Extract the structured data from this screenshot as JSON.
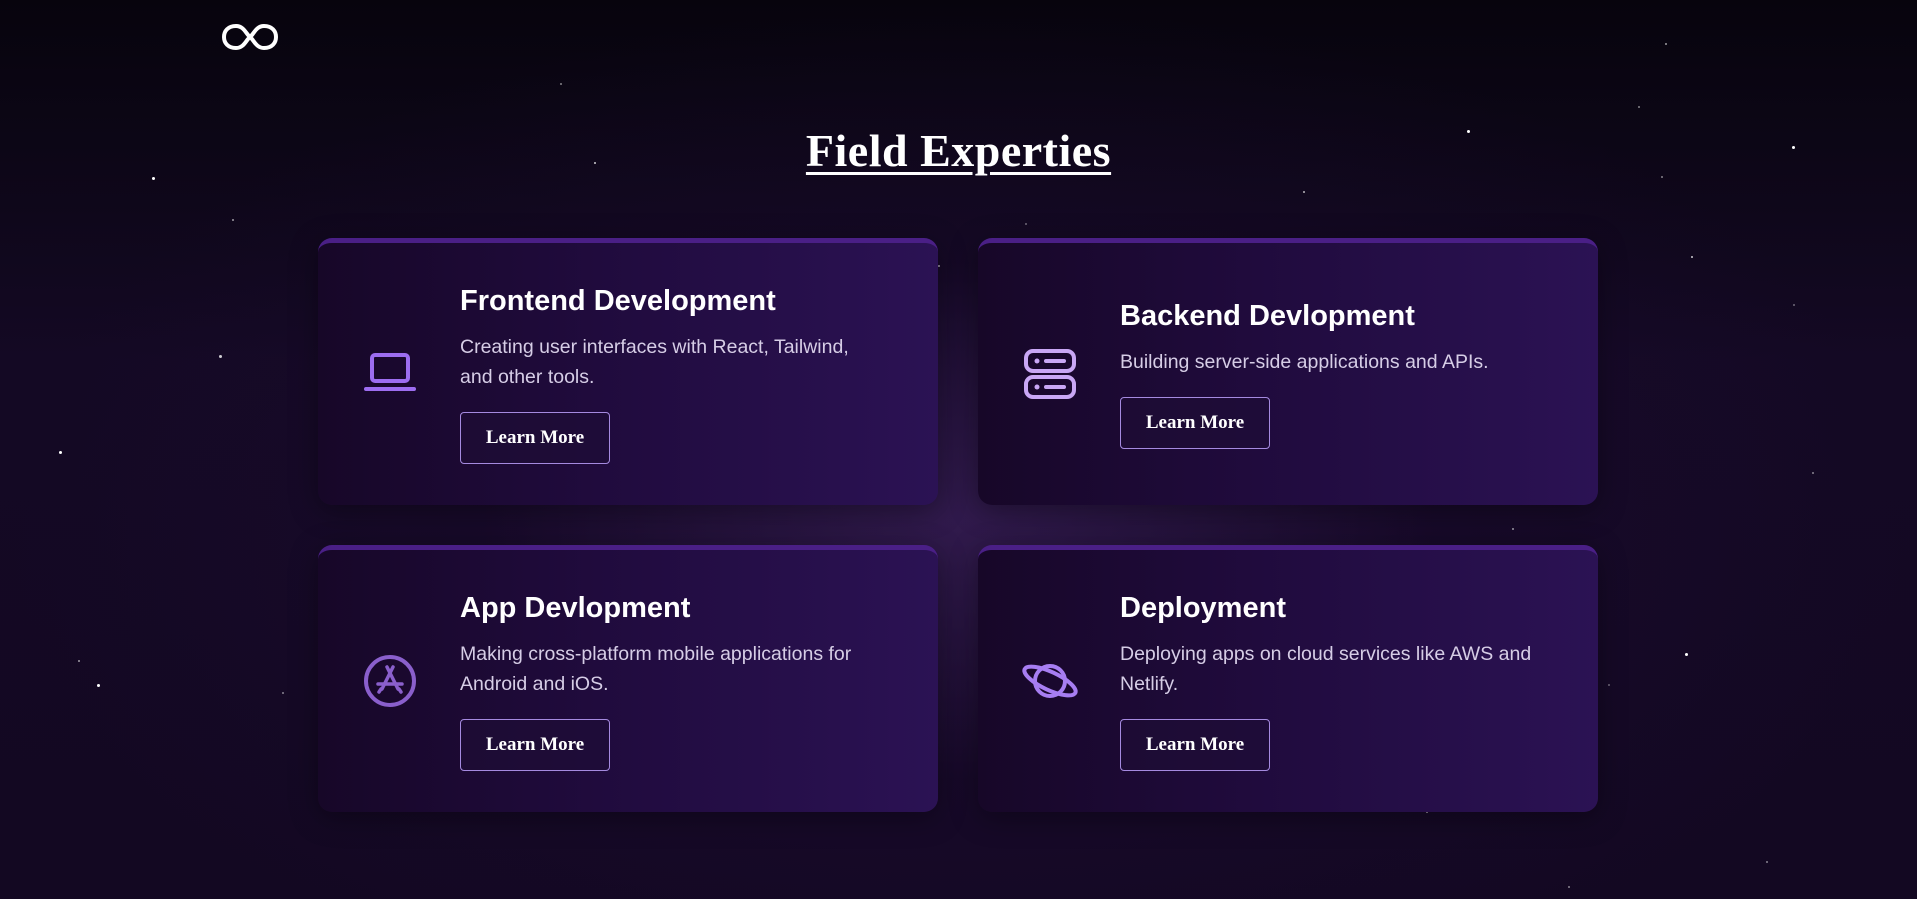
{
  "header": {
    "logo_icon": "infinity-icon"
  },
  "section": {
    "title": "Field Experties"
  },
  "cards": [
    {
      "title": "Frontend Development",
      "description": "Creating user interfaces with React, Tailwind, and other tools.",
      "button_label": "Learn More",
      "icon": "laptop-icon"
    },
    {
      "title": "Backend Devlopment",
      "description": "Building server-side applications and APIs.",
      "button_label": "Learn More",
      "icon": "server-icon"
    },
    {
      "title": "App Devlopment",
      "description": "Making cross-platform mobile applications for Android and iOS.",
      "button_label": "Learn More",
      "icon": "app-store-icon"
    },
    {
      "title": "Deployment",
      "description": "Deploying apps on cloud services like AWS and Netlify.",
      "button_label": "Learn More",
      "icon": "planet-icon"
    }
  ],
  "colors": {
    "background": "#130822",
    "card_start": "#170728",
    "card_end": "#2b1254",
    "card_border": "#4a1f86",
    "icon_accent": "#9d6df0",
    "button_border": "#a58ae0",
    "text_muted": "#d6cde6"
  }
}
